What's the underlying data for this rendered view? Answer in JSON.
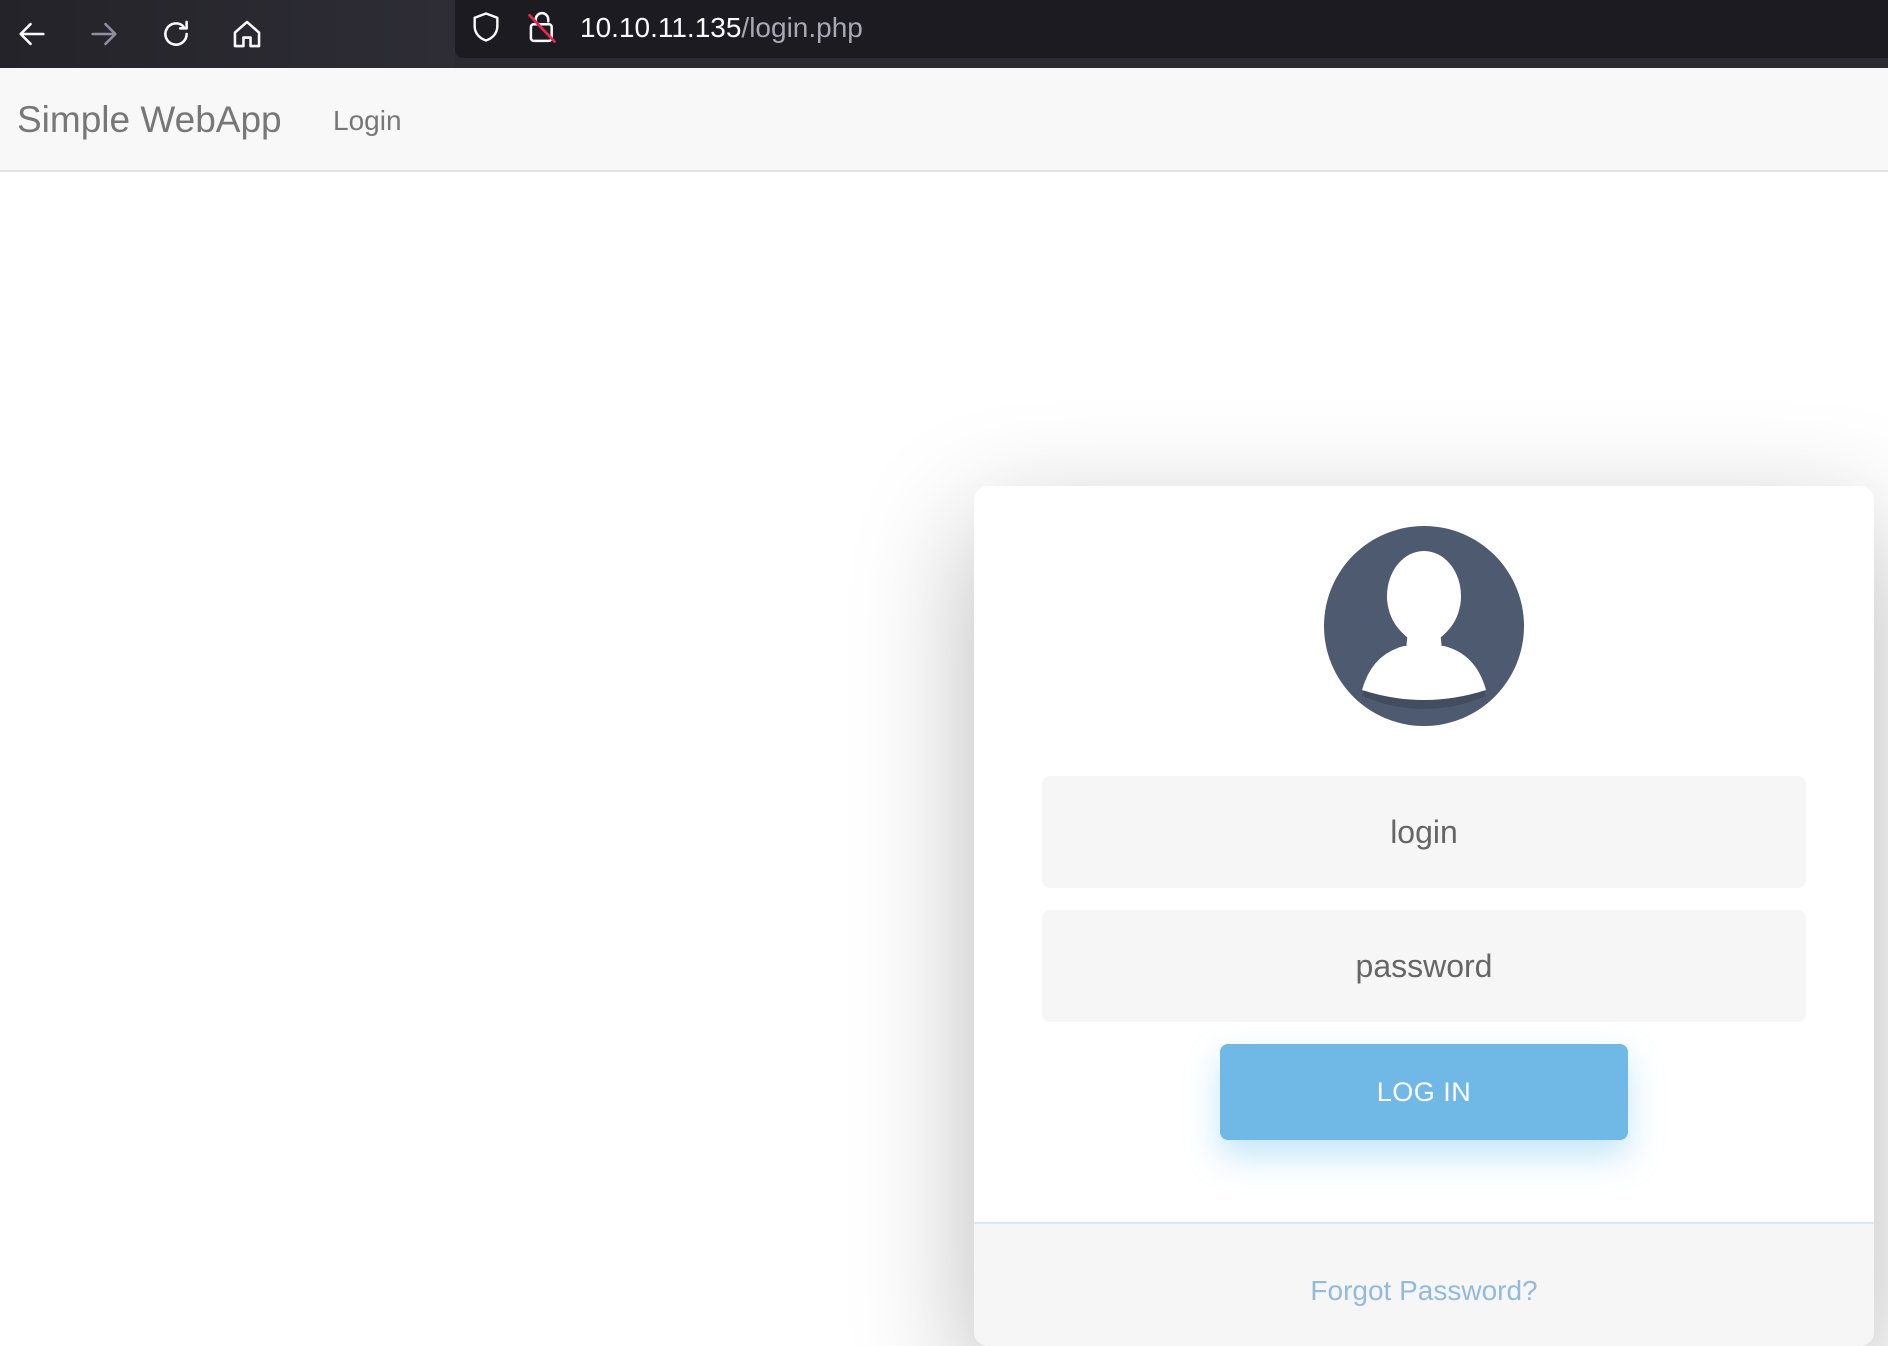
{
  "browser": {
    "url_host": "10.10.11.135",
    "url_path": "/login.php",
    "icons": [
      "back-arrow-icon",
      "forward-arrow-icon",
      "reload-icon",
      "home-icon",
      "shield-icon",
      "insecure-lock-icon"
    ]
  },
  "navbar": {
    "brand": "Simple WebApp",
    "links": [
      {
        "label": "Login"
      }
    ]
  },
  "login_form": {
    "avatar_icon": "user-avatar-icon",
    "login_placeholder": "login",
    "password_placeholder": "password",
    "submit_label": "LOG IN",
    "forgot_link": "Forgot Password?"
  },
  "colors": {
    "toolbar": "#2b2a33",
    "urlbar": "#1c1b22",
    "avatar": "#4e5a70",
    "button": "#70b8e6",
    "link": "#92badd"
  }
}
